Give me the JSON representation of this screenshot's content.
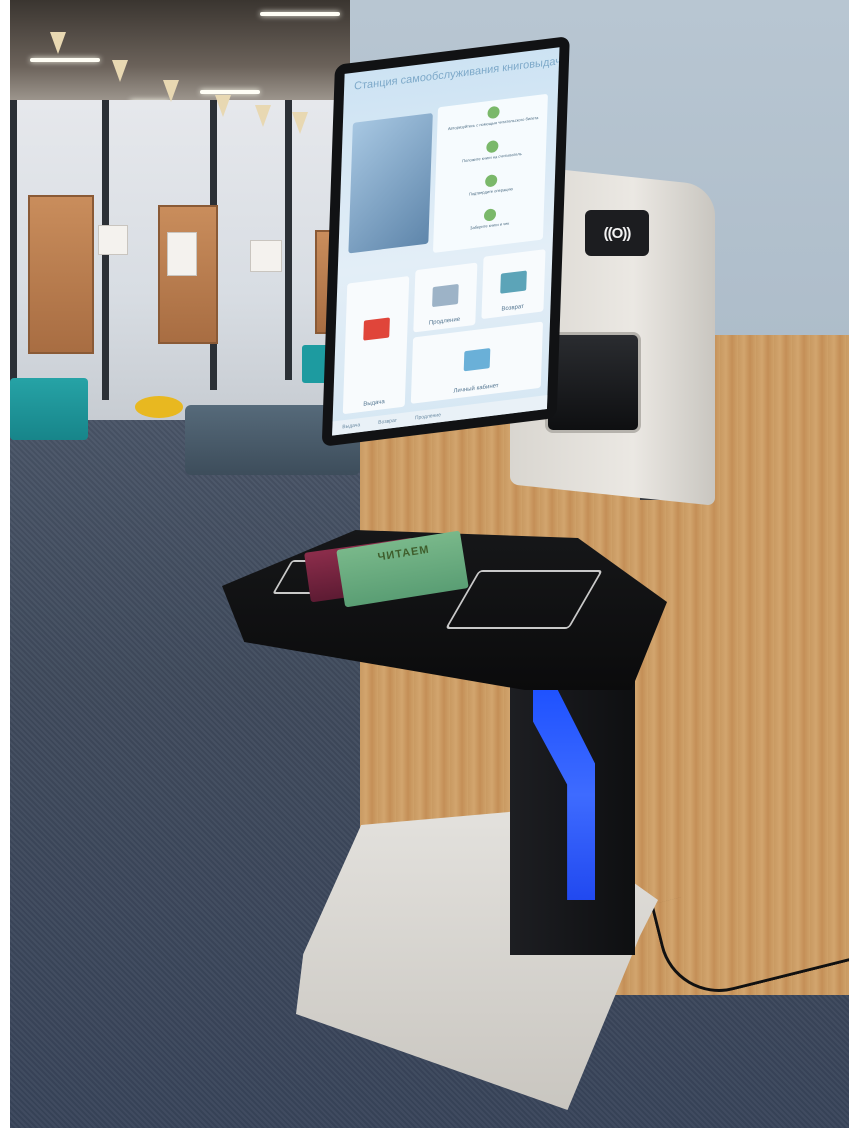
{
  "scene": {
    "description_kind": "photo",
    "kiosk_screen": {
      "title": "Станция самообслуживания книговыдачи",
      "steps": [
        "Авторизуйтесь с помощью читательского билета",
        "Положите книги на считыватель",
        "Подтвердите операцию",
        "Заберите книги и чек"
      ],
      "tiles": [
        "Продление",
        "Возврат",
        "Выдача",
        "Личный кабинет"
      ],
      "footer_items": [
        "Выдача",
        "Возврат",
        "Продление"
      ]
    },
    "book_cover_title": "ЧИТАЕМ",
    "nfc_symbol": "((O))",
    "colors": {
      "wall_blue": "#b8c6d2",
      "wood": "#c99a62",
      "floor": "#3f4a5c",
      "kiosk_body": "#e6e3de",
      "accent_light": "#3e6bff",
      "ottoman_teal": "#1f8f96"
    }
  }
}
